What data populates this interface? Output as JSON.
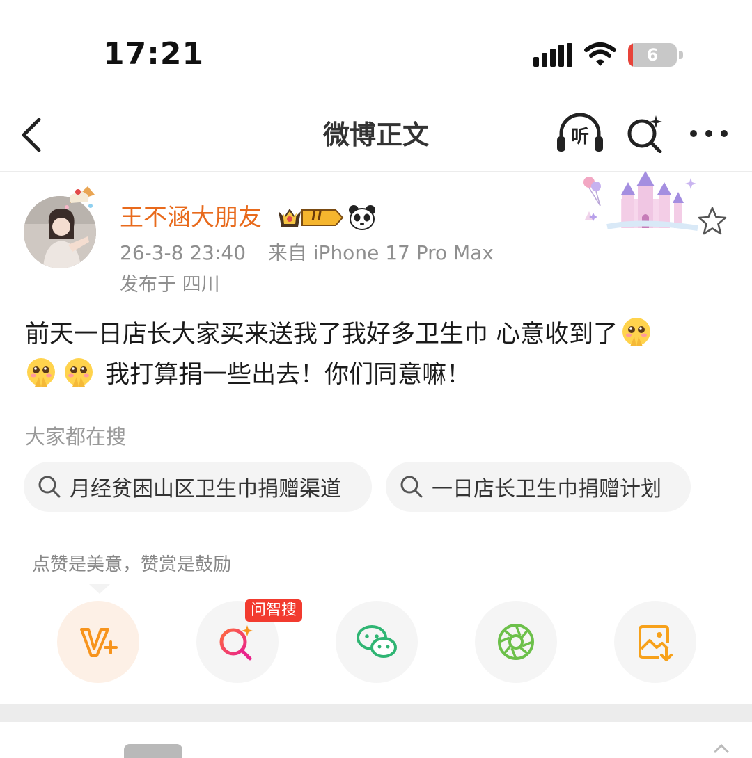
{
  "status_bar": {
    "time": "17:21",
    "battery_level": "6"
  },
  "nav": {
    "title": "微博正文",
    "listen_label": "听"
  },
  "post": {
    "username": "王不涵大朋友",
    "vip_level": "II",
    "timestamp": "26-3-8 23:40",
    "source": "来自 iPhone 17 Pro Max",
    "location": "发布于 四川",
    "body_part1": "前天一日店长大家买来送我了我好多卫生巾 心意收到了",
    "body_part2": "我打算捐一些出去！你们同意嘛！"
  },
  "hot_search": {
    "title": "大家都在搜",
    "items": [
      "月经贫困山区卫生巾捐赠渠道",
      "一日店长卫生巾捐赠计划"
    ]
  },
  "reward": {
    "tip": "点赞是美意，赞赏是鼓励",
    "ai_badge": "问智搜",
    "actions": [
      "reward-v-plus-icon",
      "ai-search-icon",
      "wechat-icon",
      "moments-icon",
      "save-image-icon"
    ]
  },
  "colors": {
    "username": "#e86a1c",
    "accent_orange": "#f7941d",
    "badge_red": "#f23b2f",
    "wechat_green": "#2fb573",
    "moments_green": "#6cc04a"
  }
}
